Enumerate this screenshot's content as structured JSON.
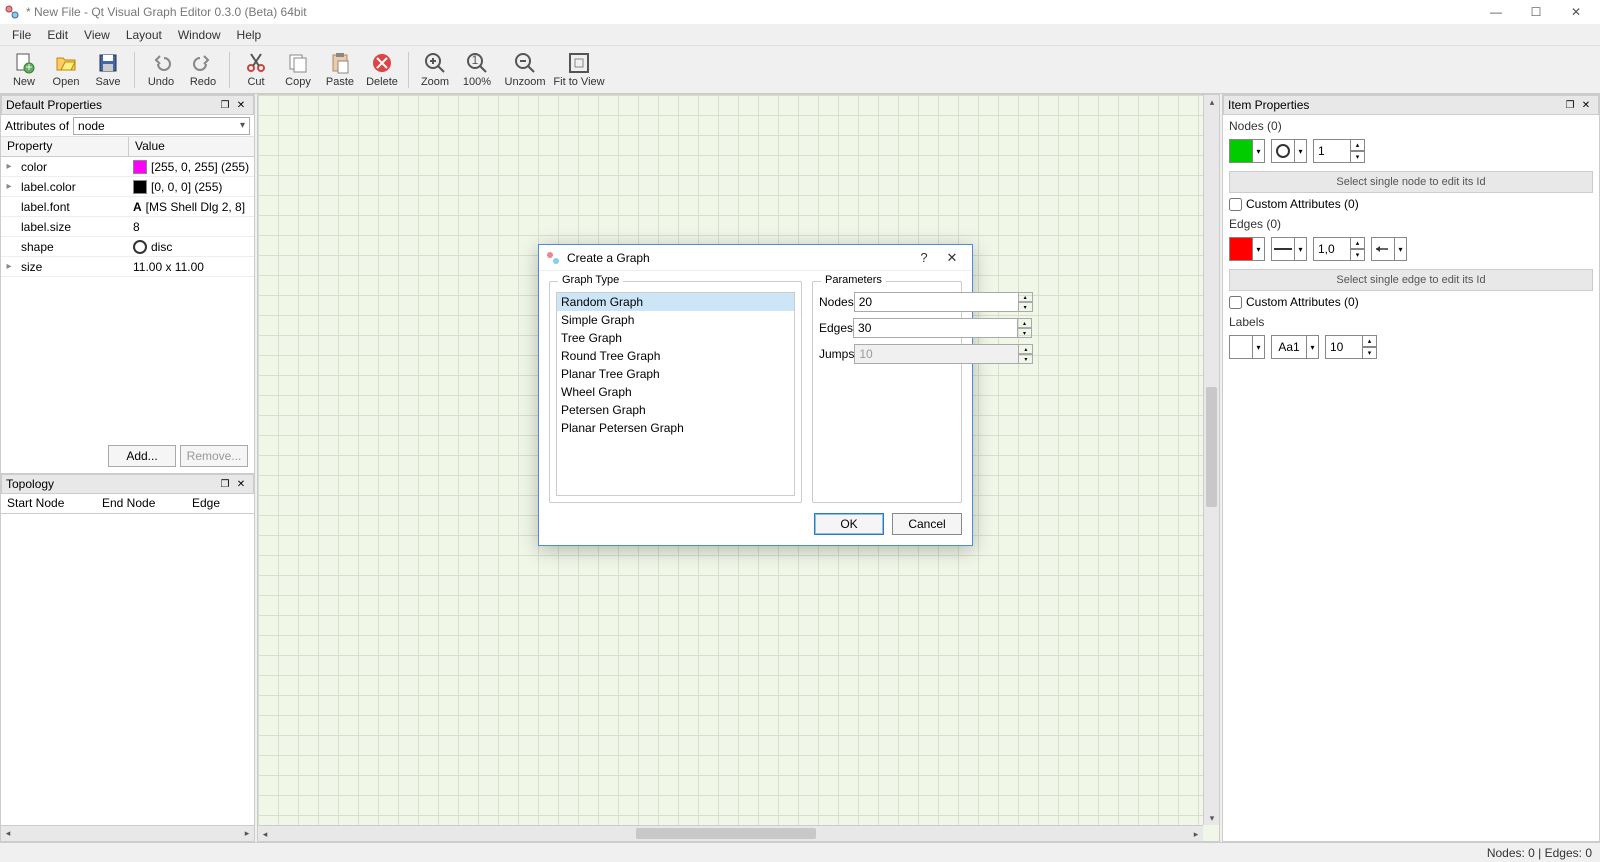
{
  "window": {
    "title": "* New File - Qt Visual Graph Editor 0.3.0 (Beta) 64bit"
  },
  "menu": [
    "File",
    "Edit",
    "View",
    "Layout",
    "Window",
    "Help"
  ],
  "toolbar": {
    "new": "New",
    "open": "Open",
    "save": "Save",
    "undo": "Undo",
    "redo": "Redo",
    "cut": "Cut",
    "copy": "Copy",
    "paste": "Paste",
    "delete": "Delete",
    "zoom": "Zoom",
    "p100": "100%",
    "unzoom": "Unzoom",
    "fit": "Fit to View"
  },
  "defaults_panel": {
    "title": "Default Properties",
    "attr_label": "Attributes of",
    "attr_value": "node",
    "cols": {
      "prop": "Property",
      "val": "Value"
    },
    "rows": {
      "color": {
        "name": "color",
        "val": "[255, 0, 255] (255)",
        "swatch": "#ff00ff"
      },
      "labelcolor": {
        "name": "label.color",
        "val": "[0, 0, 0] (255)",
        "swatch": "#000000"
      },
      "labelfont": {
        "name": "label.font",
        "val": "[MS Shell Dlg 2, 8]"
      },
      "labelsize": {
        "name": "label.size",
        "val": "8"
      },
      "shape": {
        "name": "shape",
        "val": "disc"
      },
      "size": {
        "name": "size",
        "val": "11.00 x 11.00"
      }
    },
    "add_btn": "Add...",
    "remove_btn": "Remove..."
  },
  "topology_panel": {
    "title": "Topology",
    "cols": {
      "start": "Start Node",
      "end": "End Node",
      "edge": "Edge"
    }
  },
  "item_panel": {
    "title": "Item Properties",
    "nodes_label": "Nodes (0)",
    "node_size": "1",
    "node_hint": "Select single node to edit its Id",
    "node_custom": "Custom Attributes (0)",
    "edges_label": "Edges (0)",
    "edge_weight": "1,0",
    "edge_hint": "Select single edge to edit its Id",
    "edge_custom": "Custom Attributes (0)",
    "labels_label": "Labels",
    "label_font": "Aa1",
    "label_size": "10",
    "colors": {
      "node": "#00cc00",
      "edge": "#ff0000",
      "label": "#ffffff"
    }
  },
  "dialog": {
    "title": "Create a Graph",
    "graph_type_label": "Graph Type",
    "params_label": "Parameters",
    "types": [
      "Random Graph",
      "Simple Graph",
      "Tree Graph",
      "Round Tree Graph",
      "Planar Tree Graph",
      "Wheel Graph",
      "Petersen Graph",
      "Planar Petersen Graph"
    ],
    "selected_index": 0,
    "params": {
      "nodes": {
        "label": "Nodes",
        "value": "20"
      },
      "edges": {
        "label": "Edges",
        "value": "30"
      },
      "jumps": {
        "label": "Jumps",
        "value": "10",
        "disabled": true
      }
    },
    "ok": "OK",
    "cancel": "Cancel"
  },
  "status": "Nodes: 0 | Edges: 0"
}
